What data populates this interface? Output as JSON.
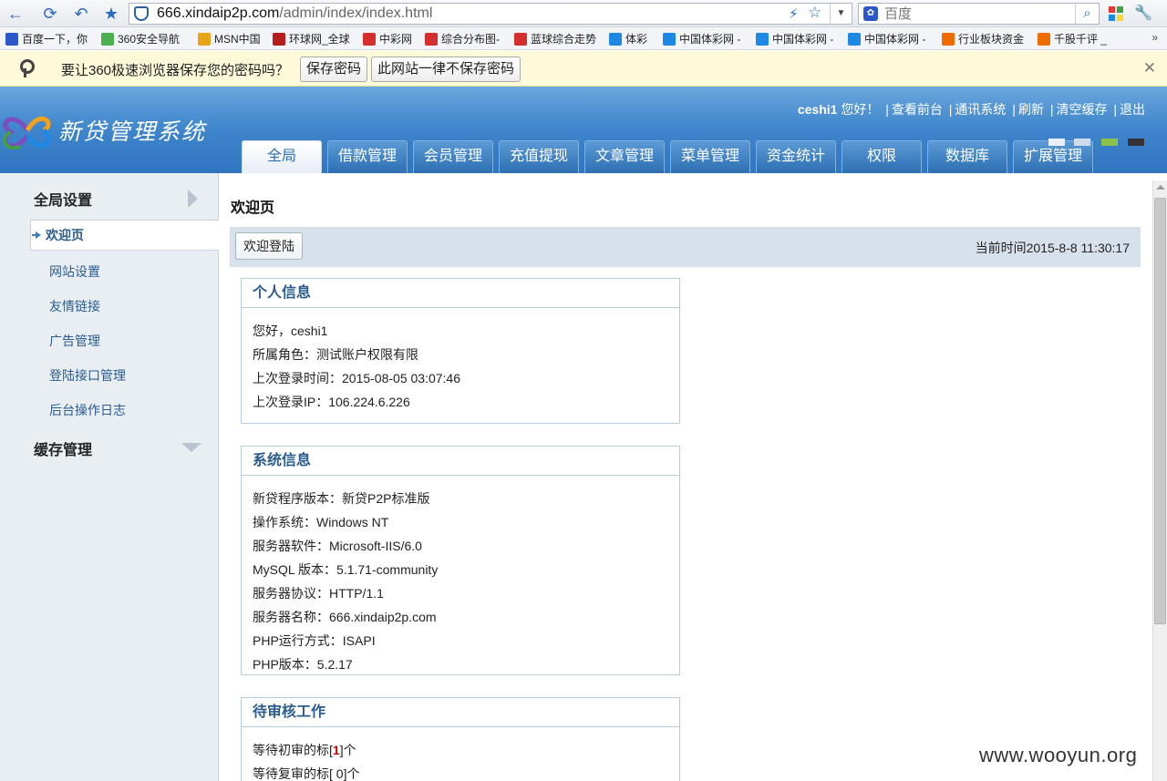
{
  "browser": {
    "url_host": "666.xindaip2p.com",
    "url_path": "/admin/index/index.html",
    "search_placeholder": "百度",
    "bookmarks": [
      {
        "label": "百度一下，你",
        "color": "#2b57c9"
      },
      {
        "label": "360安全导航",
        "color": "#4caf50"
      },
      {
        "label": "MSN中国",
        "color": "#e8a419"
      },
      {
        "label": "环球网_全球",
        "color": "#b71c1c"
      },
      {
        "label": "中彩网",
        "color": "#d32f2f"
      },
      {
        "label": "综合分布图-",
        "color": "#d32f2f"
      },
      {
        "label": "蓝球综合走势",
        "color": "#d32f2f"
      },
      {
        "label": "体彩",
        "color": "#1e88e5"
      },
      {
        "label": "中国体彩网 -",
        "color": "#1e88e5"
      },
      {
        "label": "中国体彩网 -",
        "color": "#1e88e5"
      },
      {
        "label": "中国体彩网 -",
        "color": "#1e88e5"
      },
      {
        "label": "行业板块资金",
        "color": "#ef6c00"
      },
      {
        "label": "千股千评 _",
        "color": "#ef6c00"
      }
    ],
    "bookmarks_more": "»",
    "password_prompt": "要让360极速浏览器保存您的密码吗？",
    "save_password": "保存密码",
    "never_save": "此网站一律不保存密码",
    "close": "✕"
  },
  "header": {
    "logo_text": "新贷管理系统",
    "username": "ceshi1",
    "greeting": " 您好！",
    "links": [
      "查看前台",
      "通讯系统",
      "刷新",
      "清空缓存",
      "退出"
    ],
    "nav_tabs": [
      "全局",
      "借款管理",
      "会员管理",
      "充值提现",
      "文章管理",
      "菜单管理",
      "资金统计",
      "权限",
      "数据库",
      "扩展管理"
    ],
    "active_tab": "全局",
    "skin_colors": [
      "#e8eef5",
      "#cfdcea",
      "#8bc34a",
      "#333333"
    ]
  },
  "sidebar": {
    "section1": "全局设置",
    "items": [
      "欢迎页",
      "网站设置",
      "友情链接",
      "广告管理",
      "登陆接口管理",
      "后台操作日志"
    ],
    "section2": "缓存管理"
  },
  "main": {
    "page_title": "欢迎页",
    "welcome_button": "欢迎登陆",
    "current_time": "当前时间2015-8-8 11:30:17",
    "personal": {
      "title": "个人信息",
      "rows": [
        "您好，ceshi1",
        "所属角色：测试账户权限有限",
        "上次登录时间：2015-08-05 03:07:46",
        "上次登录IP：106.224.6.226"
      ]
    },
    "system": {
      "title": "系统信息",
      "rows": [
        "新贷程序版本：新贷P2P标准版",
        "操作系统：Windows NT",
        "服务器软件：Microsoft-IIS/6.0",
        "MySQL 版本：5.1.71-community",
        "服务器协议：HTTP/1.1",
        "服务器名称：666.xindaip2p.com",
        "PHP运行方式：ISAPI",
        "PHP版本：5.2.17"
      ]
    },
    "pending": {
      "title": "待审核工作",
      "row1_prefix": "等待初审的标[",
      "row1_num": "1",
      "row1_suffix": "]个",
      "row2_prefix": "等待复审的标[",
      "row2_num": " 0",
      "row2_suffix": "]个"
    }
  },
  "watermark": "www.wooyun.org"
}
